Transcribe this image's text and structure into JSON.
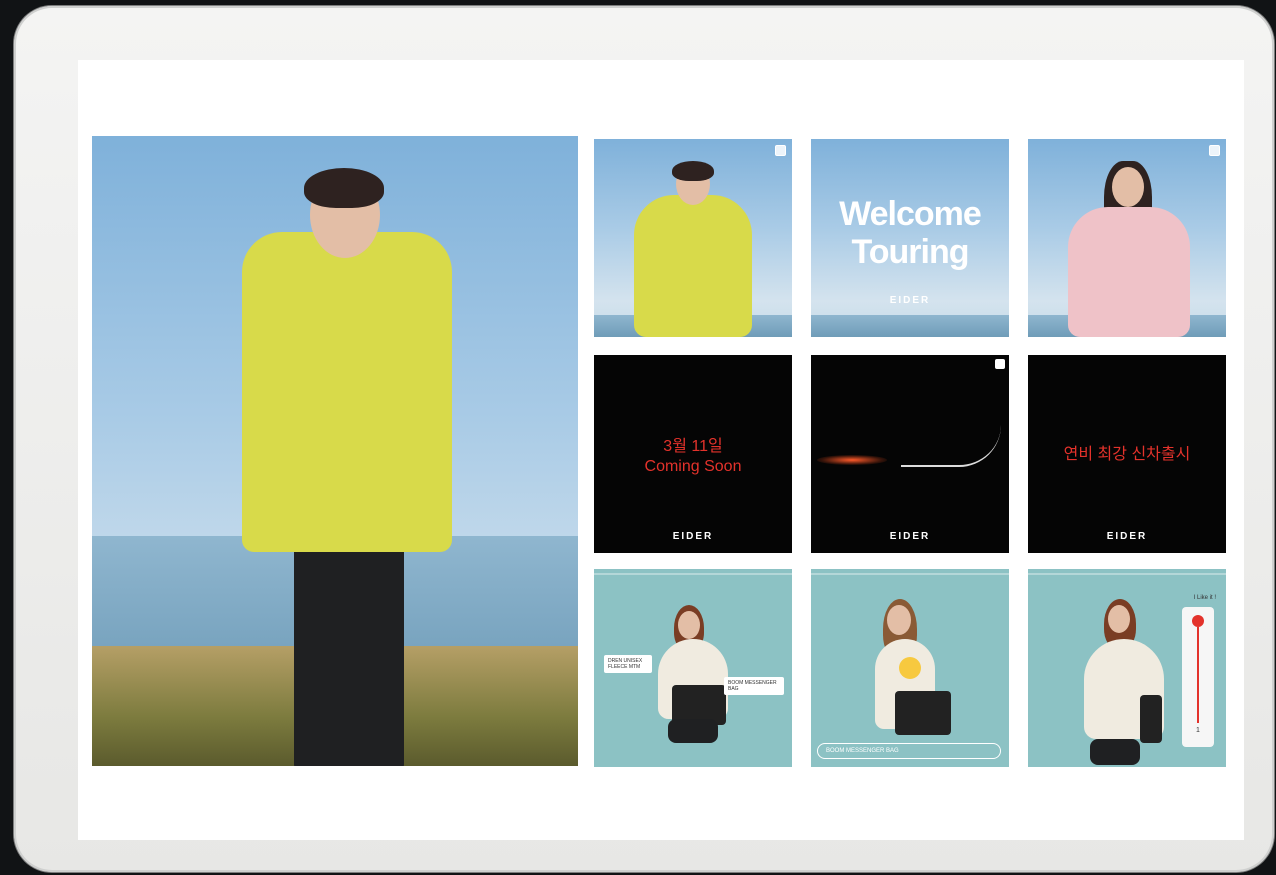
{
  "brand": "EIDER",
  "tiles": {
    "welcome_title_line1": "Welcome",
    "welcome_title_line2": "Touring",
    "coming_soon_date": "3월 11일",
    "coming_soon_text": "Coming Soon",
    "launch_text": "연비 최강 신차출시",
    "bubble_left": "DREN UNISEX FLEECE MTM",
    "bubble_right": "BOOM MESSENGER BAG",
    "search_placeholder": "BOOM MESSENGER BAG",
    "like_label": "I Like it !",
    "like_value": "1"
  },
  "colors": {
    "jacket_yellow": "#d8da4a",
    "jacket_pink": "#efc2c8",
    "teal_bg": "#8cc2c4",
    "red_text": "#e3322b"
  }
}
